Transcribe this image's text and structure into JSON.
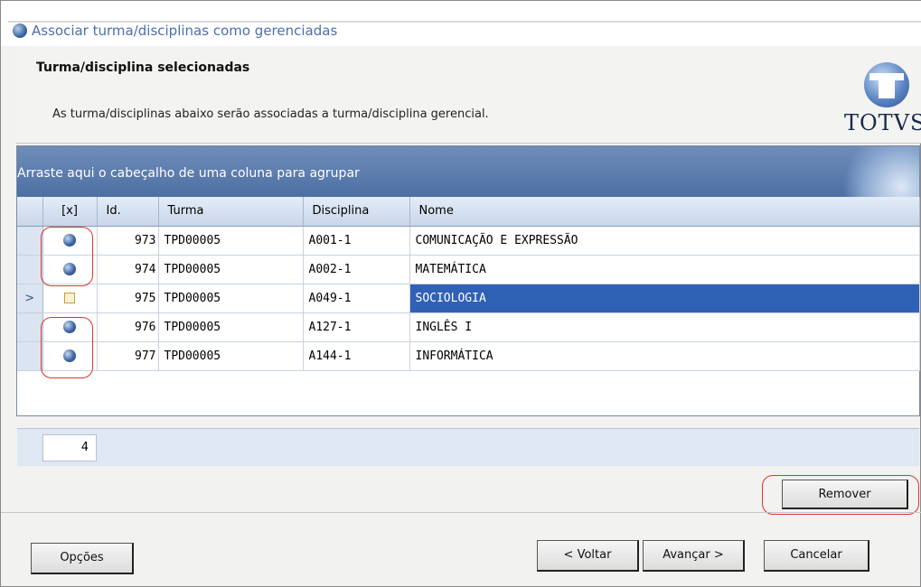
{
  "window": {
    "title": "Associar turma/disciplinas como gerenciadas"
  },
  "header": {
    "title": "Turma/disciplina selecionadas",
    "description": "As turma/disciplinas abaixo serão associadas a turma/disciplina gerencial.",
    "logo_text": "TOTVS"
  },
  "grid": {
    "group_hint": "Arraste aqui o cabeçalho de uma coluna para agrupar",
    "columns": [
      "[x]",
      "Id.",
      "Turma",
      "Disciplina",
      "Nome"
    ],
    "rows": [
      {
        "id": "973",
        "turma": "TPD00005",
        "disciplina": "A001-1",
        "nome": "COMUNICAÇÃO E EXPRESSÃO",
        "icon": "globe-icon"
      },
      {
        "id": "974",
        "turma": "TPD00005",
        "disciplina": "A002-1",
        "nome": "MATEMÁTICA",
        "icon": "globe-icon"
      },
      {
        "id": "975",
        "turma": "TPD00005",
        "disciplina": "A049-1",
        "nome": "SOCIOLOGIA",
        "icon": "checkbox-icon",
        "current_row_marker": ">"
      },
      {
        "id": "976",
        "turma": "TPD00005",
        "disciplina": "A127-1",
        "nome": "INGLÊS I",
        "icon": "globe-icon"
      },
      {
        "id": "977",
        "turma": "TPD00005",
        "disciplina": "A144-1",
        "nome": "INFORMÁTICA",
        "icon": "globe-icon"
      }
    ],
    "count": "4"
  },
  "buttons": {
    "remover": "Remover",
    "opcoes": "Opções",
    "voltar": "< Voltar",
    "avancar": "Avançar >",
    "cancelar": "Cancelar"
  },
  "colors": {
    "selection": "#2f61b5",
    "group_bar": "#5b7bad",
    "highlight_oval": "#e0332d"
  }
}
